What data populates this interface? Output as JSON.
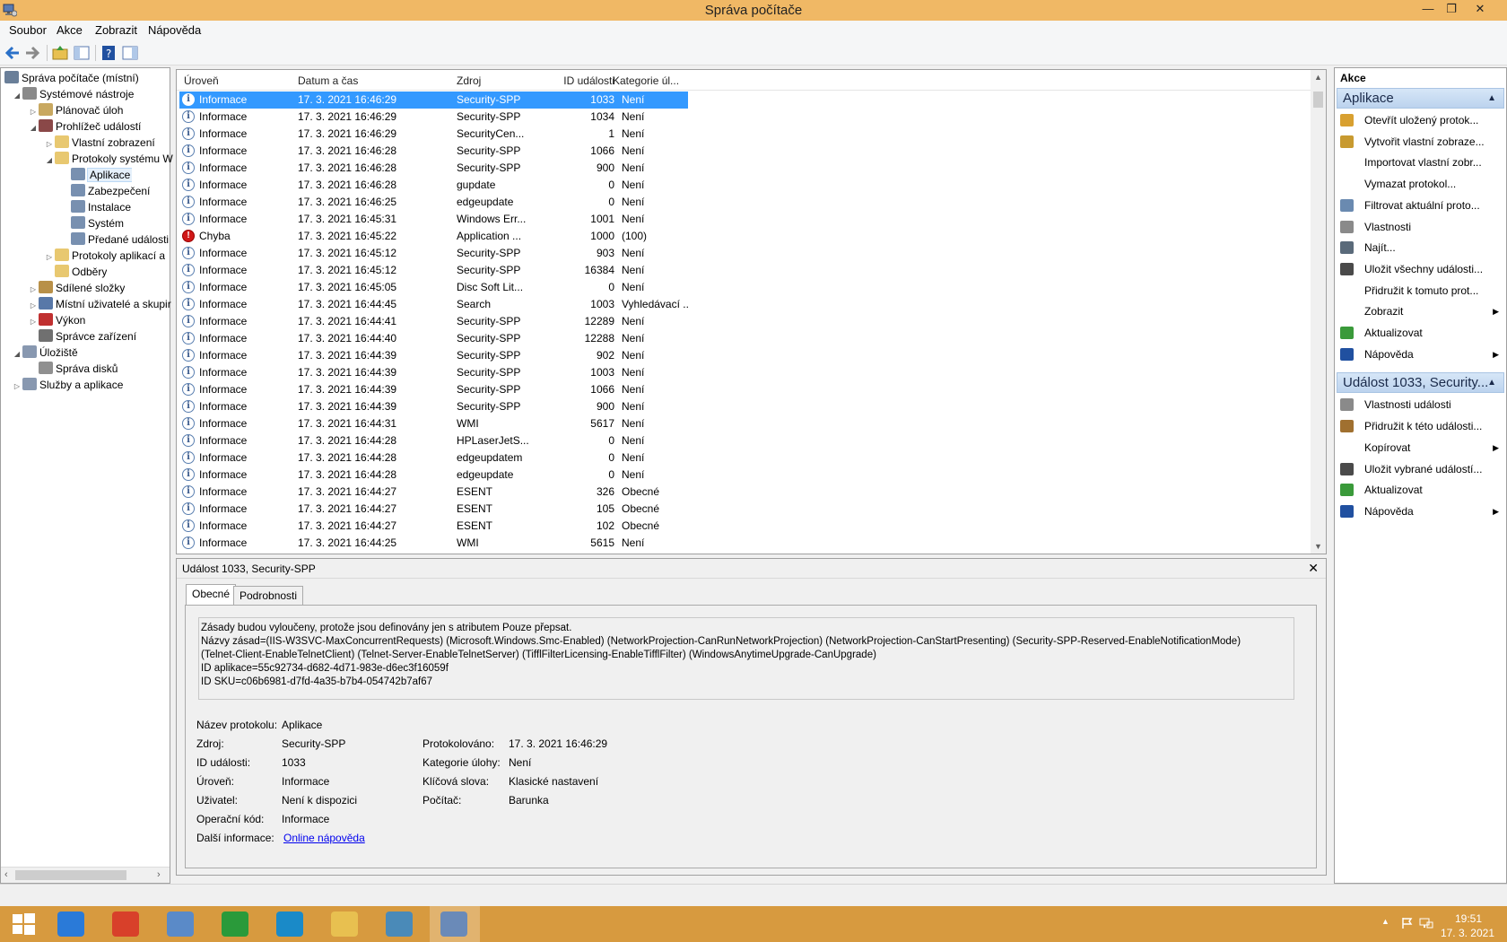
{
  "window": {
    "title": "Správa počítače"
  },
  "menu": [
    "Soubor",
    "Akce",
    "Zobrazit",
    "Nápověda"
  ],
  "tree": [
    {
      "label": "Správa počítače (místní)",
      "level": 0,
      "arrow": "",
      "icon_color": "#6a7f99"
    },
    {
      "label": "Systémové nástroje",
      "level": 1,
      "arrow": "◢",
      "icon_color": "#8a8a8a"
    },
    {
      "label": "Plánovač úloh",
      "level": 2,
      "arrow": "▷",
      "icon_color": "#c8a860"
    },
    {
      "label": "Prohlížeč událostí",
      "level": 2,
      "arrow": "◢",
      "icon_color": "#8a4848"
    },
    {
      "label": "Vlastní zobrazení",
      "level": 3,
      "arrow": "▷",
      "icon_color": "#e8c870"
    },
    {
      "label": "Protokoly systému W",
      "level": 3,
      "arrow": "◢",
      "icon_color": "#e8c870"
    },
    {
      "label": "Aplikace",
      "level": 4,
      "arrow": "",
      "icon_color": "#7890b0",
      "selected": true
    },
    {
      "label": "Zabezpečení",
      "level": 4,
      "arrow": "",
      "icon_color": "#7890b0"
    },
    {
      "label": "Instalace",
      "level": 4,
      "arrow": "",
      "icon_color": "#7890b0"
    },
    {
      "label": "Systém",
      "level": 4,
      "arrow": "",
      "icon_color": "#7890b0"
    },
    {
      "label": "Předané události",
      "level": 4,
      "arrow": "",
      "icon_color": "#7890b0"
    },
    {
      "label": "Protokoly aplikací a",
      "level": 3,
      "arrow": "▷",
      "icon_color": "#e8c870"
    },
    {
      "label": "Odběry",
      "level": 3,
      "arrow": "",
      "icon_color": "#e8c870"
    },
    {
      "label": "Sdílené složky",
      "level": 2,
      "arrow": "▷",
      "icon_color": "#b89048"
    },
    {
      "label": "Místní uživatelé a skupir",
      "level": 2,
      "arrow": "▷",
      "icon_color": "#5878a8"
    },
    {
      "label": "Výkon",
      "level": 2,
      "arrow": "▷",
      "icon_color": "#c03030"
    },
    {
      "label": "Správce zařízení",
      "level": 2,
      "arrow": "",
      "icon_color": "#707070"
    },
    {
      "label": "Úložiště",
      "level": 1,
      "arrow": "◢",
      "icon_color": "#8898b0"
    },
    {
      "label": "Správa disků",
      "level": 2,
      "arrow": "",
      "icon_color": "#909090"
    },
    {
      "label": "Služby a aplikace",
      "level": 1,
      "arrow": "▷",
      "icon_color": "#8898b0"
    }
  ],
  "grid": {
    "columns": [
      "Úroveň",
      "Datum a čas",
      "Zdroj",
      "ID události",
      "Kategorie úl..."
    ],
    "rows": [
      {
        "level": "Informace",
        "date": "17. 3. 2021 16:46:29",
        "source": "Security-SPP",
        "id": "1033",
        "category": "Není",
        "selected": true
      },
      {
        "level": "Informace",
        "date": "17. 3. 2021 16:46:29",
        "source": "Security-SPP",
        "id": "1034",
        "category": "Není"
      },
      {
        "level": "Informace",
        "date": "17. 3. 2021 16:46:29",
        "source": "SecurityCen...",
        "id": "1",
        "category": "Není"
      },
      {
        "level": "Informace",
        "date": "17. 3. 2021 16:46:28",
        "source": "Security-SPP",
        "id": "1066",
        "category": "Není"
      },
      {
        "level": "Informace",
        "date": "17. 3. 2021 16:46:28",
        "source": "Security-SPP",
        "id": "900",
        "category": "Není"
      },
      {
        "level": "Informace",
        "date": "17. 3. 2021 16:46:28",
        "source": "gupdate",
        "id": "0",
        "category": "Není"
      },
      {
        "level": "Informace",
        "date": "17. 3. 2021 16:46:25",
        "source": "edgeupdate",
        "id": "0",
        "category": "Není"
      },
      {
        "level": "Informace",
        "date": "17. 3. 2021 16:45:31",
        "source": "Windows Err...",
        "id": "1001",
        "category": "Není"
      },
      {
        "level": "Chyba",
        "date": "17. 3. 2021 16:45:22",
        "source": "Application ...",
        "id": "1000",
        "category": "(100)",
        "error": true
      },
      {
        "level": "Informace",
        "date": "17. 3. 2021 16:45:12",
        "source": "Security-SPP",
        "id": "903",
        "category": "Není"
      },
      {
        "level": "Informace",
        "date": "17. 3. 2021 16:45:12",
        "source": "Security-SPP",
        "id": "16384",
        "category": "Není"
      },
      {
        "level": "Informace",
        "date": "17. 3. 2021 16:45:05",
        "source": "Disc Soft Lit...",
        "id": "0",
        "category": "Není"
      },
      {
        "level": "Informace",
        "date": "17. 3. 2021 16:44:45",
        "source": "Search",
        "id": "1003",
        "category": "Vyhledávací ..."
      },
      {
        "level": "Informace",
        "date": "17. 3. 2021 16:44:41",
        "source": "Security-SPP",
        "id": "12289",
        "category": "Není"
      },
      {
        "level": "Informace",
        "date": "17. 3. 2021 16:44:40",
        "source": "Security-SPP",
        "id": "12288",
        "category": "Není"
      },
      {
        "level": "Informace",
        "date": "17. 3. 2021 16:44:39",
        "source": "Security-SPP",
        "id": "902",
        "category": "Není"
      },
      {
        "level": "Informace",
        "date": "17. 3. 2021 16:44:39",
        "source": "Security-SPP",
        "id": "1003",
        "category": "Není"
      },
      {
        "level": "Informace",
        "date": "17. 3. 2021 16:44:39",
        "source": "Security-SPP",
        "id": "1066",
        "category": "Není"
      },
      {
        "level": "Informace",
        "date": "17. 3. 2021 16:44:39",
        "source": "Security-SPP",
        "id": "900",
        "category": "Není"
      },
      {
        "level": "Informace",
        "date": "17. 3. 2021 16:44:31",
        "source": "WMI",
        "id": "5617",
        "category": "Není"
      },
      {
        "level": "Informace",
        "date": "17. 3. 2021 16:44:28",
        "source": "HPLaserJetS...",
        "id": "0",
        "category": "Není"
      },
      {
        "level": "Informace",
        "date": "17. 3. 2021 16:44:28",
        "source": "edgeupdatem",
        "id": "0",
        "category": "Není"
      },
      {
        "level": "Informace",
        "date": "17. 3. 2021 16:44:28",
        "source": "edgeupdate",
        "id": "0",
        "category": "Není"
      },
      {
        "level": "Informace",
        "date": "17. 3. 2021 16:44:27",
        "source": "ESENT",
        "id": "326",
        "category": "Obecné"
      },
      {
        "level": "Informace",
        "date": "17. 3. 2021 16:44:27",
        "source": "ESENT",
        "id": "105",
        "category": "Obecné"
      },
      {
        "level": "Informace",
        "date": "17. 3. 2021 16:44:27",
        "source": "ESENT",
        "id": "102",
        "category": "Obecné"
      },
      {
        "level": "Informace",
        "date": "17. 3. 2021 16:44:25",
        "source": "WMI",
        "id": "5615",
        "category": "Není"
      }
    ]
  },
  "detail": {
    "title": "Událost 1033, Security-SPP",
    "tabs": [
      "Obecné",
      "Podrobnosti"
    ],
    "description": [
      "Zásady budou vyloučeny, protože jsou definovány jen s atributem Pouze přepsat.",
      "Názvy zásad=(IIS-W3SVC-MaxConcurrentRequests) (Microsoft.Windows.Smc-Enabled) (NetworkProjection-CanRunNetworkProjection) (NetworkProjection-CanStartPresenting) (Security-SPP-Reserved-EnableNotificationMode)",
      "(Telnet-Client-EnableTelnetClient) (Telnet-Server-EnableTelnetServer) (TifflFilterLicensing-EnableTifflFilter) (WindowsAnytimeUpgrade-CanUpgrade)",
      "ID aplikace=55c92734-d682-4d71-983e-d6ec3f16059f",
      "ID SKU=c06b6981-d7fd-4a35-b7b4-054742b7af67"
    ],
    "props": {
      "log_name_label": "Název protokolu:",
      "log_name": "Aplikace",
      "source_label": "Zdroj:",
      "source": "Security-SPP",
      "logged_label": "Protokolováno:",
      "logged": "17. 3. 2021 16:46:29",
      "event_id_label": "ID události:",
      "event_id": "1033",
      "task_label": "Kategorie úlohy:",
      "task": "Není",
      "level_label": "Úroveň:",
      "level": "Informace",
      "keywords_label": "Klíčová slova:",
      "keywords": "Klasické nastavení",
      "user_label": "Uživatel:",
      "user": "Není k dispozici",
      "computer_label": "Počítač:",
      "computer": "Barunka",
      "opcode_label": "Operační kód:",
      "opcode": "Informace",
      "more_label": "Další informace:",
      "more_link": "Online nápověda"
    }
  },
  "actions": {
    "title": "Akce",
    "groups": [
      {
        "label": "Aplikace",
        "items": [
          {
            "label": "Otevřít uložený protok...",
            "icon": "folder-open-icon",
            "color": "#d8a030"
          },
          {
            "label": "Vytvořit vlastní zobraze...",
            "icon": "filter-icon",
            "color": "#c89a30"
          },
          {
            "label": "Importovat vlastní zobr...",
            "icon": "",
            "color": ""
          },
          {
            "label": "Vymazat protokol...",
            "icon": "",
            "color": ""
          },
          {
            "label": "Filtrovat aktuální proto...",
            "icon": "filter-icon",
            "color": "#6a8ab0"
          },
          {
            "label": "Vlastnosti",
            "icon": "properties-icon",
            "color": "#8a8a8a"
          },
          {
            "label": "Najít...",
            "icon": "binoculars-icon",
            "color": "#5a6a7a"
          },
          {
            "label": "Uložit všechny události...",
            "icon": "save-icon",
            "color": "#4a4a4a"
          },
          {
            "label": "Přidružit k tomuto prot...",
            "icon": "",
            "color": ""
          },
          {
            "label": "Zobrazit",
            "icon": "",
            "color": "",
            "submenu": true
          },
          {
            "label": "Aktualizovat",
            "icon": "refresh-icon",
            "color": "#3a9a3a"
          },
          {
            "label": "Nápověda",
            "icon": "help-icon",
            "color": "#2050a0",
            "submenu": true
          }
        ]
      },
      {
        "label": "Událost 1033, Security...",
        "items": [
          {
            "label": "Vlastnosti události",
            "icon": "properties-icon",
            "color": "#8a8a8a"
          },
          {
            "label": "Přidružit k této události...",
            "icon": "task-icon",
            "color": "#a07030"
          },
          {
            "label": "Kopírovat",
            "icon": "",
            "color": "",
            "submenu": true
          },
          {
            "label": "Uložit vybrané událostí...",
            "icon": "save-icon",
            "color": "#4a4a4a"
          },
          {
            "label": "Aktualizovat",
            "icon": "refresh-icon",
            "color": "#3a9a3a"
          },
          {
            "label": "Nápověda",
            "icon": "help-icon",
            "color": "#2050a0",
            "submenu": true
          }
        ]
      }
    ]
  },
  "taskbar": {
    "apps": [
      {
        "name": "start-button",
        "color": "#ffffff"
      },
      {
        "name": "internet-explorer-icon",
        "color": "#2a7ad8"
      },
      {
        "name": "chrome-icon",
        "color": "#d8402a"
      },
      {
        "name": "control-panel-icon",
        "color": "#5a8ac8"
      },
      {
        "name": "store-icon",
        "color": "#2a9a3a"
      },
      {
        "name": "edge-icon",
        "color": "#1a8ac8"
      },
      {
        "name": "file-explorer-icon",
        "color": "#e8c050"
      },
      {
        "name": "photo-viewer-icon",
        "color": "#4a8ab8"
      },
      {
        "name": "computer-management-icon",
        "color": "#6a8ab8",
        "active": true
      }
    ],
    "time": "19:51",
    "date": "17. 3. 2021"
  }
}
